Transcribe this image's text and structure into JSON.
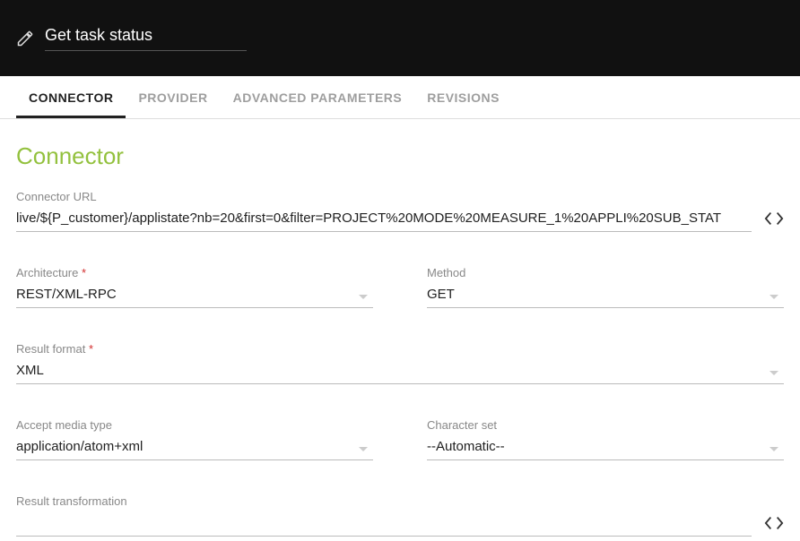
{
  "header": {
    "title": "Get task status"
  },
  "tabs": {
    "connector": "CONNECTOR",
    "provider": "PROVIDER",
    "advanced": "ADVANCED PARAMETERS",
    "revisions": "REVISIONS"
  },
  "section": {
    "title": "Connector"
  },
  "fields": {
    "connector_url": {
      "label": "Connector URL",
      "value": "live/${P_customer}/applistate?nb=20&first=0&filter=PROJECT%20MODE%20MEASURE_1%20APPLI%20SUB_STAT"
    },
    "architecture": {
      "label": "Architecture",
      "value": "REST/XML-RPC"
    },
    "method": {
      "label": "Method",
      "value": "GET"
    },
    "result_format": {
      "label": "Result format",
      "value": "XML"
    },
    "accept_media": {
      "label": "Accept media type",
      "value": "application/atom+xml"
    },
    "charset": {
      "label": "Character set",
      "value": "--Automatic--"
    },
    "result_transform": {
      "label": "Result transformation",
      "value": ""
    }
  },
  "required_marker": "*"
}
